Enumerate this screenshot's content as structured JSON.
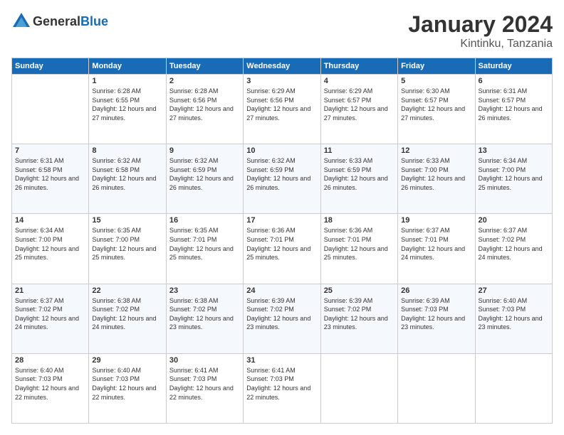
{
  "header": {
    "logo_general": "General",
    "logo_blue": "Blue",
    "month": "January 2024",
    "location": "Kintinku, Tanzania"
  },
  "weekdays": [
    "Sunday",
    "Monday",
    "Tuesday",
    "Wednesday",
    "Thursday",
    "Friday",
    "Saturday"
  ],
  "weeks": [
    [
      {
        "day": "",
        "sunrise": "",
        "sunset": "",
        "daylight": ""
      },
      {
        "day": "1",
        "sunrise": "Sunrise: 6:28 AM",
        "sunset": "Sunset: 6:55 PM",
        "daylight": "Daylight: 12 hours and 27 minutes."
      },
      {
        "day": "2",
        "sunrise": "Sunrise: 6:28 AM",
        "sunset": "Sunset: 6:56 PM",
        "daylight": "Daylight: 12 hours and 27 minutes."
      },
      {
        "day": "3",
        "sunrise": "Sunrise: 6:29 AM",
        "sunset": "Sunset: 6:56 PM",
        "daylight": "Daylight: 12 hours and 27 minutes."
      },
      {
        "day": "4",
        "sunrise": "Sunrise: 6:29 AM",
        "sunset": "Sunset: 6:57 PM",
        "daylight": "Daylight: 12 hours and 27 minutes."
      },
      {
        "day": "5",
        "sunrise": "Sunrise: 6:30 AM",
        "sunset": "Sunset: 6:57 PM",
        "daylight": "Daylight: 12 hours and 27 minutes."
      },
      {
        "day": "6",
        "sunrise": "Sunrise: 6:31 AM",
        "sunset": "Sunset: 6:57 PM",
        "daylight": "Daylight: 12 hours and 26 minutes."
      }
    ],
    [
      {
        "day": "7",
        "sunrise": "Sunrise: 6:31 AM",
        "sunset": "Sunset: 6:58 PM",
        "daylight": "Daylight: 12 hours and 26 minutes."
      },
      {
        "day": "8",
        "sunrise": "Sunrise: 6:32 AM",
        "sunset": "Sunset: 6:58 PM",
        "daylight": "Daylight: 12 hours and 26 minutes."
      },
      {
        "day": "9",
        "sunrise": "Sunrise: 6:32 AM",
        "sunset": "Sunset: 6:59 PM",
        "daylight": "Daylight: 12 hours and 26 minutes."
      },
      {
        "day": "10",
        "sunrise": "Sunrise: 6:32 AM",
        "sunset": "Sunset: 6:59 PM",
        "daylight": "Daylight: 12 hours and 26 minutes."
      },
      {
        "day": "11",
        "sunrise": "Sunrise: 6:33 AM",
        "sunset": "Sunset: 6:59 PM",
        "daylight": "Daylight: 12 hours and 26 minutes."
      },
      {
        "day": "12",
        "sunrise": "Sunrise: 6:33 AM",
        "sunset": "Sunset: 7:00 PM",
        "daylight": "Daylight: 12 hours and 26 minutes."
      },
      {
        "day": "13",
        "sunrise": "Sunrise: 6:34 AM",
        "sunset": "Sunset: 7:00 PM",
        "daylight": "Daylight: 12 hours and 25 minutes."
      }
    ],
    [
      {
        "day": "14",
        "sunrise": "Sunrise: 6:34 AM",
        "sunset": "Sunset: 7:00 PM",
        "daylight": "Daylight: 12 hours and 25 minutes."
      },
      {
        "day": "15",
        "sunrise": "Sunrise: 6:35 AM",
        "sunset": "Sunset: 7:00 PM",
        "daylight": "Daylight: 12 hours and 25 minutes."
      },
      {
        "day": "16",
        "sunrise": "Sunrise: 6:35 AM",
        "sunset": "Sunset: 7:01 PM",
        "daylight": "Daylight: 12 hours and 25 minutes."
      },
      {
        "day": "17",
        "sunrise": "Sunrise: 6:36 AM",
        "sunset": "Sunset: 7:01 PM",
        "daylight": "Daylight: 12 hours and 25 minutes."
      },
      {
        "day": "18",
        "sunrise": "Sunrise: 6:36 AM",
        "sunset": "Sunset: 7:01 PM",
        "daylight": "Daylight: 12 hours and 25 minutes."
      },
      {
        "day": "19",
        "sunrise": "Sunrise: 6:37 AM",
        "sunset": "Sunset: 7:01 PM",
        "daylight": "Daylight: 12 hours and 24 minutes."
      },
      {
        "day": "20",
        "sunrise": "Sunrise: 6:37 AM",
        "sunset": "Sunset: 7:02 PM",
        "daylight": "Daylight: 12 hours and 24 minutes."
      }
    ],
    [
      {
        "day": "21",
        "sunrise": "Sunrise: 6:37 AM",
        "sunset": "Sunset: 7:02 PM",
        "daylight": "Daylight: 12 hours and 24 minutes."
      },
      {
        "day": "22",
        "sunrise": "Sunrise: 6:38 AM",
        "sunset": "Sunset: 7:02 PM",
        "daylight": "Daylight: 12 hours and 24 minutes."
      },
      {
        "day": "23",
        "sunrise": "Sunrise: 6:38 AM",
        "sunset": "Sunset: 7:02 PM",
        "daylight": "Daylight: 12 hours and 23 minutes."
      },
      {
        "day": "24",
        "sunrise": "Sunrise: 6:39 AM",
        "sunset": "Sunset: 7:02 PM",
        "daylight": "Daylight: 12 hours and 23 minutes."
      },
      {
        "day": "25",
        "sunrise": "Sunrise: 6:39 AM",
        "sunset": "Sunset: 7:02 PM",
        "daylight": "Daylight: 12 hours and 23 minutes."
      },
      {
        "day": "26",
        "sunrise": "Sunrise: 6:39 AM",
        "sunset": "Sunset: 7:03 PM",
        "daylight": "Daylight: 12 hours and 23 minutes."
      },
      {
        "day": "27",
        "sunrise": "Sunrise: 6:40 AM",
        "sunset": "Sunset: 7:03 PM",
        "daylight": "Daylight: 12 hours and 23 minutes."
      }
    ],
    [
      {
        "day": "28",
        "sunrise": "Sunrise: 6:40 AM",
        "sunset": "Sunset: 7:03 PM",
        "daylight": "Daylight: 12 hours and 22 minutes."
      },
      {
        "day": "29",
        "sunrise": "Sunrise: 6:40 AM",
        "sunset": "Sunset: 7:03 PM",
        "daylight": "Daylight: 12 hours and 22 minutes."
      },
      {
        "day": "30",
        "sunrise": "Sunrise: 6:41 AM",
        "sunset": "Sunset: 7:03 PM",
        "daylight": "Daylight: 12 hours and 22 minutes."
      },
      {
        "day": "31",
        "sunrise": "Sunrise: 6:41 AM",
        "sunset": "Sunset: 7:03 PM",
        "daylight": "Daylight: 12 hours and 22 minutes."
      },
      {
        "day": "",
        "sunrise": "",
        "sunset": "",
        "daylight": ""
      },
      {
        "day": "",
        "sunrise": "",
        "sunset": "",
        "daylight": ""
      },
      {
        "day": "",
        "sunrise": "",
        "sunset": "",
        "daylight": ""
      }
    ]
  ]
}
